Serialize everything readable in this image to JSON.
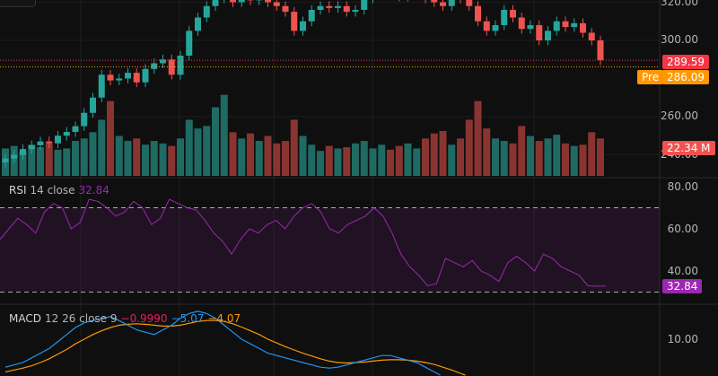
{
  "price_axis": {
    "labels": [
      "320.00",
      "300.00",
      "260.00",
      "240.00"
    ],
    "values": [
      320,
      300,
      260,
      240
    ]
  },
  "tags": {
    "last_price": "289.59",
    "pre_label": "Pre",
    "pre_price": "286.09",
    "volume": "22.34 M"
  },
  "colors": {
    "up": "#26a69a",
    "down": "#ef5350",
    "rsi": "#9c27b0",
    "macd": "#2196f3",
    "signal": "#ff9800",
    "hist": "#e91e63",
    "last": "#f23645",
    "pre": "#ff9800"
  },
  "rsi": {
    "name": "RSI",
    "params": "14 close",
    "value": "32.84",
    "axis": [
      "80.00",
      "60.00",
      "40.00"
    ],
    "axis_values": [
      80,
      60,
      40
    ],
    "upper": 70,
    "lower": 30
  },
  "macd": {
    "name": "MACD",
    "params": "12 26 close 9",
    "hist": "−0.9990",
    "macd": "−5.07",
    "signal": "−4.07",
    "axis": [
      "10.00"
    ],
    "axis_values": [
      10
    ]
  },
  "chart_data": {
    "type": "candlestick",
    "closes": [
      238,
      240,
      243,
      245,
      247,
      246,
      250,
      252,
      255,
      262,
      270,
      282,
      279,
      280,
      283,
      278,
      285,
      288,
      290,
      282,
      292,
      305,
      312,
      318,
      322,
      325,
      320,
      323,
      321,
      326,
      320,
      318,
      315,
      305,
      310,
      316,
      318,
      317,
      318,
      315,
      316,
      322,
      325,
      327,
      326,
      323,
      324,
      325,
      322,
      320,
      318,
      328,
      322,
      318,
      310,
      305,
      308,
      316,
      312,
      306,
      308,
      300,
      305,
      310,
      307,
      309,
      304,
      300,
      289.59
    ],
    "volume": [
      22,
      24,
      20,
      25,
      23,
      26,
      21,
      22,
      28,
      30,
      35,
      45,
      60,
      32,
      28,
      30,
      25,
      28,
      26,
      24,
      30,
      45,
      38,
      40,
      55,
      65,
      35,
      30,
      34,
      28,
      32,
      26,
      28,
      45,
      32,
      25,
      20,
      24,
      22,
      23,
      26,
      28,
      22,
      25,
      21,
      24,
      26,
      22,
      30,
      34,
      36,
      25,
      30,
      45,
      60,
      38,
      30,
      28,
      26,
      40,
      32,
      28,
      30,
      33,
      26,
      24,
      25,
      35,
      30
    ],
    "rsi": [
      55,
      60,
      65,
      62,
      58,
      68,
      72,
      70,
      60,
      63,
      74,
      73,
      70,
      66,
      68,
      73,
      70,
      62,
      65,
      74,
      72,
      70,
      69,
      64,
      58,
      54,
      48,
      55,
      60,
      58,
      62,
      64,
      60,
      66,
      70,
      72,
      68,
      60,
      58,
      62,
      64,
      66,
      70,
      66,
      58,
      48,
      42,
      38,
      33,
      34,
      46,
      44,
      42,
      45,
      40,
      38,
      35,
      44,
      47,
      44,
      40,
      48,
      46,
      42,
      40,
      38,
      33,
      32.8,
      32.84
    ],
    "macd": [
      4,
      4.5,
      5,
      6,
      7,
      8,
      9.5,
      11,
      12.5,
      13.5,
      14,
      14.5,
      14.8,
      14,
      13,
      12,
      11.5,
      11,
      12,
      13,
      14.5,
      15.5,
      16,
      15.5,
      14.5,
      13,
      11.5,
      10,
      9,
      8,
      7,
      6.5,
      6,
      5.5,
      5,
      4.5,
      4,
      3.8,
      4,
      4.5,
      5,
      5.5,
      6,
      6.5,
      6.5,
      6,
      5.5,
      5,
      4,
      3,
      2,
      1,
      0,
      -1,
      -2,
      -3,
      -4,
      -4.5,
      -5,
      -5,
      -5.2,
      -5.3,
      -5.2,
      -5.1,
      -5.1,
      -5,
      -5,
      -5.07,
      -5.07
    ],
    "signal": [
      3,
      3.4,
      3.8,
      4.3,
      5,
      5.8,
      6.8,
      7.8,
      9,
      10,
      11,
      11.8,
      12.5,
      13,
      13.2,
      13.3,
      13.2,
      13,
      12.8,
      12.8,
      13,
      13.4,
      13.8,
      14,
      14,
      13.8,
      13.3,
      12.6,
      11.8,
      11,
      10,
      9.2,
      8.4,
      7.7,
      7,
      6.4,
      5.8,
      5.3,
      5,
      4.9,
      5,
      5.1,
      5.3,
      5.5,
      5.6,
      5.6,
      5.5,
      5.3,
      5,
      4.6,
      4,
      3.4,
      2.7,
      2,
      1.2,
      0.4,
      -0.4,
      -1.2,
      -2,
      -2.6,
      -3.1,
      -3.5,
      -3.8,
      -4,
      -4,
      -4.05,
      -4.07,
      -4.07,
      -4.07
    ]
  }
}
